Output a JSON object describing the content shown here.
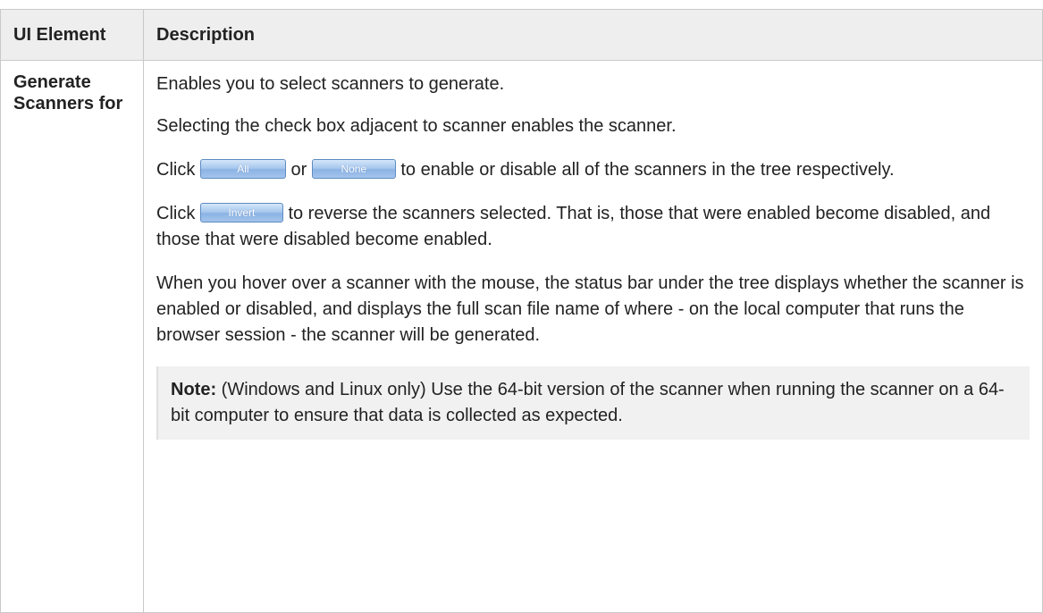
{
  "table": {
    "headers": {
      "element": "UI Element",
      "description": "Description"
    },
    "rows": [
      {
        "element": "Generate Scanners for",
        "paragraphs": {
          "p1": "Enables you to select scanners to generate.",
          "p2": "Selecting the check box adjacent to scanner enables the scanner.",
          "p3_before": "Click ",
          "p3_middle": " or ",
          "p3_after": " to enable or disable all of the scanners in the tree respectively.",
          "p4_before": "Click ",
          "p4_after": " to reverse the scanners selected. That is, those that were enabled become disabled, and those that were disabled become enabled.",
          "p5": "When you hover over a scanner with the mouse, the status bar under the tree displays whether the scanner is enabled or disabled, and displays the full scan file name of where - on the local computer that runs the browser session - the scanner will be generated."
        },
        "buttons": {
          "all": "All",
          "none": "None",
          "invert": "Invert"
        },
        "note": {
          "label": "Note:",
          "text": " (Windows and Linux only) Use the 64-bit version of the scanner when running the scanner on a 64-bit computer to ensure that data is collected as expected."
        }
      }
    ]
  },
  "colors": {
    "header_bg": "#eeeeee",
    "border": "#c9c9c9",
    "note_bg": "#f1f1f1",
    "button_blue": "#8cb3e4"
  }
}
